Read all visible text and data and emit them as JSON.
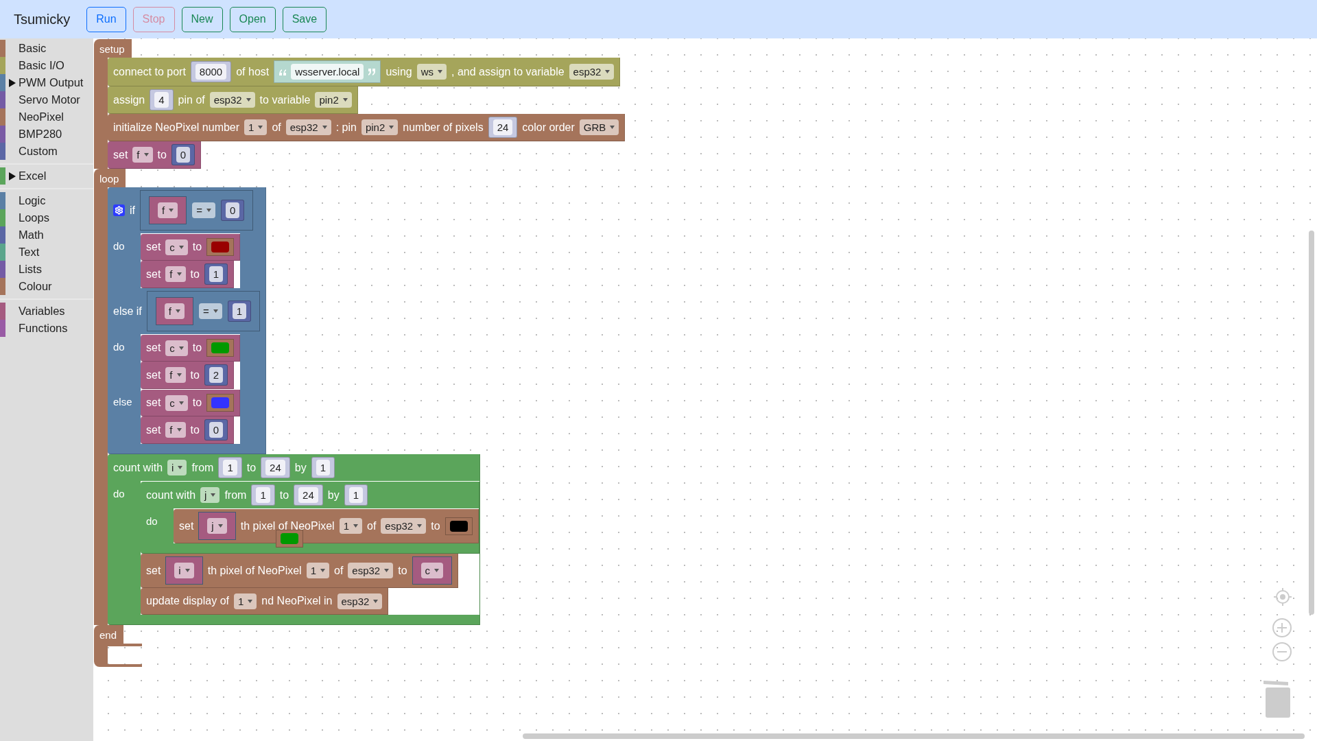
{
  "app": {
    "title": "Tsumicky"
  },
  "toolbar": [
    {
      "label": "Run",
      "kind": "primary",
      "disabled": false
    },
    {
      "label": "Stop",
      "kind": "danger",
      "disabled": true
    },
    {
      "label": "New",
      "kind": "success",
      "disabled": false
    },
    {
      "label": "Open",
      "kind": "success",
      "disabled": false
    },
    {
      "label": "Save",
      "kind": "success",
      "disabled": false
    }
  ],
  "category_groups": [
    {
      "items": [
        {
          "label": "Basic",
          "color": "#a5745b",
          "expandable": false
        },
        {
          "label": "Basic I/O",
          "color": "#a5a55b",
          "expandable": false
        },
        {
          "label": "PWM Output",
          "color": "#5b80a5",
          "expandable": true
        },
        {
          "label": "Servo Motor",
          "color": "#745ba5",
          "expandable": false
        },
        {
          "label": "NeoPixel",
          "color": "#a5745b",
          "expandable": false
        },
        {
          "label": "BMP280",
          "color": "#7a5ba5",
          "expandable": false
        },
        {
          "label": "Custom",
          "color": "#5b67a5",
          "expandable": false
        }
      ]
    },
    {
      "items": [
        {
          "label": "Excel",
          "color": "#5ba55b",
          "expandable": true
        }
      ]
    },
    {
      "items": [
        {
          "label": "Logic",
          "color": "#5b80a5",
          "expandable": false
        },
        {
          "label": "Loops",
          "color": "#5ba55b",
          "expandable": false
        },
        {
          "label": "Math",
          "color": "#5b67a5",
          "expandable": false
        },
        {
          "label": "Text",
          "color": "#5ba58c",
          "expandable": false
        },
        {
          "label": "Lists",
          "color": "#745ba5",
          "expandable": false
        },
        {
          "label": "Colour",
          "color": "#a5745b",
          "expandable": false
        }
      ]
    },
    {
      "items": [
        {
          "label": "Variables",
          "color": "#a55b80",
          "expandable": false
        },
        {
          "label": "Functions",
          "color": "#995ba5",
          "expandable": false
        }
      ]
    }
  ],
  "program": {
    "color": "#a5745b",
    "sections": [
      {
        "label": "setup",
        "blocks": [
          {
            "color": "#a5a55b",
            "rows": [
              {
                "kind": "inline",
                "parts": [
                  {
                    "kind": "label",
                    "text": "connect to port"
                  },
                  {
                    "kind": "number",
                    "text": "8000",
                    "shadow": true
                  },
                  {
                    "kind": "label",
                    "text": "of host"
                  },
                  {
                    "kind": "string",
                    "text": "wsserver.local"
                  },
                  {
                    "kind": "label",
                    "text": "using"
                  },
                  {
                    "kind": "dropdown",
                    "text": "ws"
                  },
                  {
                    "kind": "label",
                    "text": ", and assign to variable"
                  },
                  {
                    "kind": "dropdown",
                    "text": "esp32"
                  }
                ]
              }
            ]
          },
          {
            "color": "#a5a55b",
            "rows": [
              {
                "kind": "inline",
                "parts": [
                  {
                    "kind": "label",
                    "text": "assign"
                  },
                  {
                    "kind": "number",
                    "text": "4",
                    "shadow": true
                  },
                  {
                    "kind": "label",
                    "text": "pin of"
                  },
                  {
                    "kind": "dropdown",
                    "text": "esp32"
                  },
                  {
                    "kind": "label",
                    "text": "to variable"
                  },
                  {
                    "kind": "dropdown",
                    "text": "pin2"
                  }
                ]
              }
            ]
          },
          {
            "color": "#a5745b",
            "rows": [
              {
                "kind": "inline",
                "parts": [
                  {
                    "kind": "label",
                    "text": "initialize NeoPixel number"
                  },
                  {
                    "kind": "dropdown",
                    "text": "1"
                  },
                  {
                    "kind": "label",
                    "text": "of"
                  },
                  {
                    "kind": "dropdown",
                    "text": "esp32"
                  },
                  {
                    "kind": "label",
                    "text": ": pin"
                  },
                  {
                    "kind": "dropdown",
                    "text": "pin2"
                  },
                  {
                    "kind": "label",
                    "text": "number of pixels"
                  },
                  {
                    "kind": "number",
                    "text": "24",
                    "shadow": true
                  },
                  {
                    "kind": "label",
                    "text": "color order"
                  },
                  {
                    "kind": "dropdown",
                    "text": "GRB"
                  }
                ]
              }
            ]
          },
          {
            "color": "#a55b80",
            "rows": [
              {
                "kind": "inline",
                "parts": [
                  {
                    "kind": "label",
                    "text": "set"
                  },
                  {
                    "kind": "dropdown",
                    "text": "f"
                  },
                  {
                    "kind": "label",
                    "text": "to"
                  },
                  {
                    "kind": "number",
                    "text": "0",
                    "shadow": false
                  }
                ]
              }
            ]
          }
        ]
      },
      {
        "label": "loop",
        "blocks": [
          {
            "color": "#5b80a5",
            "gear": true,
            "rows": [
              {
                "kind": "inline",
                "parts": [
                  {
                    "kind": "label",
                    "text": "if"
                  },
                  {
                    "kind": "block",
                    "color": "#5b80a5",
                    "parts": [
                      {
                        "kind": "block",
                        "color": "#a55b80",
                        "parts": [
                          {
                            "kind": "dropdown",
                            "text": "f"
                          }
                        ]
                      },
                      {
                        "kind": "dropdown",
                        "text": "="
                      },
                      {
                        "kind": "number",
                        "text": "0",
                        "shadow": false
                      }
                    ]
                  }
                ]
              },
              {
                "kind": "statement",
                "label": "do",
                "blocks": [
                  {
                    "color": "#a55b80",
                    "rows": [
                      {
                        "kind": "inline",
                        "parts": [
                          {
                            "kind": "label",
                            "text": "set"
                          },
                          {
                            "kind": "dropdown",
                            "text": "c"
                          },
                          {
                            "kind": "label",
                            "text": "to"
                          },
                          {
                            "kind": "colour",
                            "color": "#990000"
                          }
                        ]
                      }
                    ]
                  },
                  {
                    "color": "#a55b80",
                    "rows": [
                      {
                        "kind": "inline",
                        "parts": [
                          {
                            "kind": "label",
                            "text": "set"
                          },
                          {
                            "kind": "dropdown",
                            "text": "f"
                          },
                          {
                            "kind": "label",
                            "text": "to"
                          },
                          {
                            "kind": "number",
                            "text": "1",
                            "shadow": false
                          }
                        ]
                      }
                    ]
                  }
                ]
              },
              {
                "kind": "inline",
                "parts": [
                  {
                    "kind": "label",
                    "text": "else if"
                  },
                  {
                    "kind": "block",
                    "color": "#5b80a5",
                    "parts": [
                      {
                        "kind": "block",
                        "color": "#a55b80",
                        "parts": [
                          {
                            "kind": "dropdown",
                            "text": "f"
                          }
                        ]
                      },
                      {
                        "kind": "dropdown",
                        "text": "="
                      },
                      {
                        "kind": "number",
                        "text": "1",
                        "shadow": false
                      }
                    ]
                  }
                ]
              },
              {
                "kind": "statement",
                "label": "do",
                "blocks": [
                  {
                    "color": "#a55b80",
                    "rows": [
                      {
                        "kind": "inline",
                        "parts": [
                          {
                            "kind": "label",
                            "text": "set"
                          },
                          {
                            "kind": "dropdown",
                            "text": "c"
                          },
                          {
                            "kind": "label",
                            "text": "to"
                          },
                          {
                            "kind": "colour",
                            "color": "#009900"
                          }
                        ]
                      }
                    ]
                  },
                  {
                    "color": "#a55b80",
                    "rows": [
                      {
                        "kind": "inline",
                        "parts": [
                          {
                            "kind": "label",
                            "text": "set"
                          },
                          {
                            "kind": "dropdown",
                            "text": "f"
                          },
                          {
                            "kind": "label",
                            "text": "to"
                          },
                          {
                            "kind": "number",
                            "text": "2",
                            "shadow": false
                          }
                        ]
                      }
                    ]
                  }
                ]
              },
              {
                "kind": "statement",
                "label": "else",
                "blocks": [
                  {
                    "color": "#a55b80",
                    "rows": [
                      {
                        "kind": "inline",
                        "parts": [
                          {
                            "kind": "label",
                            "text": "set"
                          },
                          {
                            "kind": "dropdown",
                            "text": "c"
                          },
                          {
                            "kind": "label",
                            "text": "to"
                          },
                          {
                            "kind": "colour",
                            "color": "#3333ff"
                          }
                        ]
                      }
                    ]
                  },
                  {
                    "color": "#a55b80",
                    "rows": [
                      {
                        "kind": "inline",
                        "parts": [
                          {
                            "kind": "label",
                            "text": "set"
                          },
                          {
                            "kind": "dropdown",
                            "text": "f"
                          },
                          {
                            "kind": "label",
                            "text": "to"
                          },
                          {
                            "kind": "number",
                            "text": "0",
                            "shadow": false
                          }
                        ]
                      }
                    ]
                  }
                ]
              }
            ]
          },
          {
            "color": "#5ba55b",
            "rows": [
              {
                "kind": "inline",
                "parts": [
                  {
                    "kind": "label",
                    "text": "count with"
                  },
                  {
                    "kind": "dropdown",
                    "text": "i"
                  },
                  {
                    "kind": "label",
                    "text": "from"
                  },
                  {
                    "kind": "number",
                    "text": "1",
                    "shadow": true
                  },
                  {
                    "kind": "label",
                    "text": "to"
                  },
                  {
                    "kind": "number",
                    "text": "24",
                    "shadow": true
                  },
                  {
                    "kind": "label",
                    "text": "by"
                  },
                  {
                    "kind": "number",
                    "text": "1",
                    "shadow": true
                  }
                ]
              },
              {
                "kind": "statement",
                "label": "do",
                "blocks": [
                  {
                    "color": "#5ba55b",
                    "rows": [
                      {
                        "kind": "inline",
                        "parts": [
                          {
                            "kind": "label",
                            "text": "count with"
                          },
                          {
                            "kind": "dropdown",
                            "text": "j"
                          },
                          {
                            "kind": "label",
                            "text": "from"
                          },
                          {
                            "kind": "number",
                            "text": "1",
                            "shadow": true
                          },
                          {
                            "kind": "label",
                            "text": "to"
                          },
                          {
                            "kind": "number",
                            "text": "24",
                            "shadow": true
                          },
                          {
                            "kind": "label",
                            "text": "by"
                          },
                          {
                            "kind": "number",
                            "text": "1",
                            "shadow": true
                          }
                        ]
                      },
                      {
                        "kind": "statement",
                        "label": "do",
                        "blocks": [
                          {
                            "color": "#a5745b",
                            "rows": [
                              {
                                "kind": "inline",
                                "parts": [
                                  {
                                    "kind": "label",
                                    "text": "set"
                                  },
                                  {
                                    "kind": "block",
                                    "color": "#a55b80",
                                    "parts": [
                                      {
                                        "kind": "dropdown",
                                        "text": "j"
                                      }
                                    ]
                                  },
                                  {
                                    "kind": "label",
                                    "text": "th pixel of NeoPixel"
                                  },
                                  {
                                    "kind": "dropdown",
                                    "text": "1"
                                  },
                                  {
                                    "kind": "label",
                                    "text": "of"
                                  },
                                  {
                                    "kind": "dropdown",
                                    "text": "esp32"
                                  },
                                  {
                                    "kind": "label",
                                    "text": "to"
                                  },
                                  {
                                    "kind": "colour",
                                    "color": "#000000"
                                  }
                                ]
                              }
                            ]
                          }
                        ]
                      }
                    ]
                  },
                  {
                    "color": "#a5745b",
                    "rows": [
                      {
                        "kind": "inline",
                        "parts": [
                          {
                            "kind": "label",
                            "text": "set"
                          },
                          {
                            "kind": "block",
                            "color": "#a55b80",
                            "parts": [
                              {
                                "kind": "dropdown",
                                "text": "i"
                              }
                            ]
                          },
                          {
                            "kind": "label",
                            "text": "th pixel of NeoPixel"
                          },
                          {
                            "kind": "dropdown",
                            "text": "1"
                          },
                          {
                            "kind": "label",
                            "text": "of"
                          },
                          {
                            "kind": "dropdown",
                            "text": "esp32"
                          },
                          {
                            "kind": "label",
                            "text": "to"
                          },
                          {
                            "kind": "block",
                            "color": "#a55b80",
                            "parts": [
                              {
                                "kind": "dropdown",
                                "text": "c"
                              }
                            ]
                          }
                        ]
                      }
                    ]
                  },
                  {
                    "color": "#a5745b",
                    "rows": [
                      {
                        "kind": "inline",
                        "parts": [
                          {
                            "kind": "label",
                            "text": "update display of"
                          },
                          {
                            "kind": "dropdown",
                            "text": "1"
                          },
                          {
                            "kind": "label",
                            "text": "nd NeoPixel in"
                          },
                          {
                            "kind": "dropdown",
                            "text": "esp32"
                          }
                        ]
                      }
                    ]
                  }
                ]
              }
            ]
          }
        ]
      },
      {
        "label": "end"
      }
    ]
  },
  "floating_blocks": [
    {
      "kind": "colour",
      "color": "#009900"
    }
  ]
}
